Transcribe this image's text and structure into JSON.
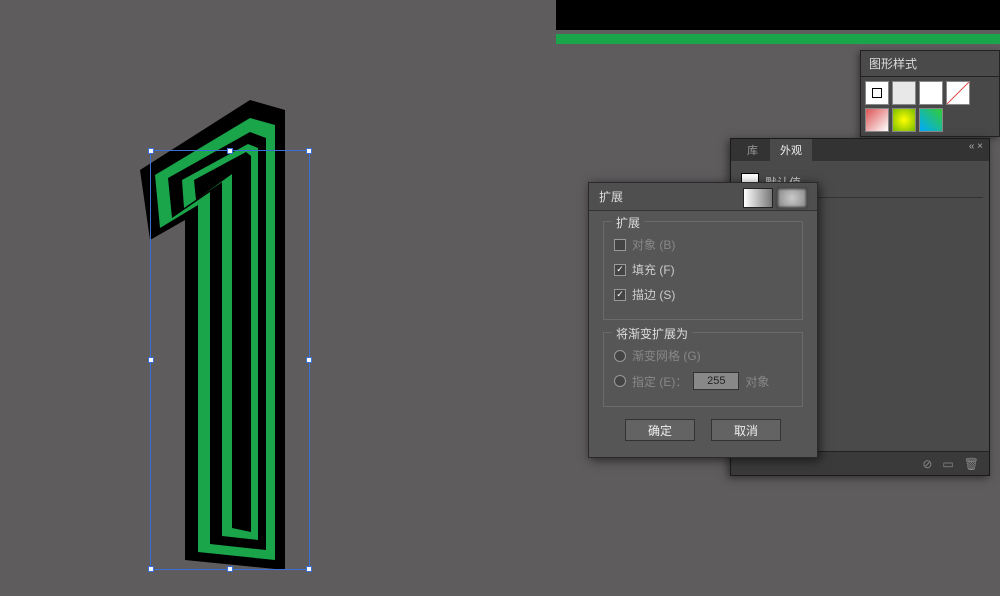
{
  "panels": {
    "graphic_styles": {
      "title": "图形样式"
    },
    "appearance": {
      "tabs": {
        "library": "库",
        "appearance": "外观"
      },
      "none_row": {
        "label": "默认值"
      }
    }
  },
  "dialog": {
    "title": "扩展",
    "expand_section": {
      "legend": "扩展",
      "object": "对象 (B)",
      "fill": "填充 (F)",
      "stroke": "描边 (S)"
    },
    "gradient_section": {
      "legend": "将渐变扩展为",
      "mesh": "渐变网格 (G)",
      "specify_prefix": "指定 (E)：",
      "specify_value": "255",
      "specify_suffix": "对象"
    },
    "buttons": {
      "ok": "确定",
      "cancel": "取消"
    }
  }
}
